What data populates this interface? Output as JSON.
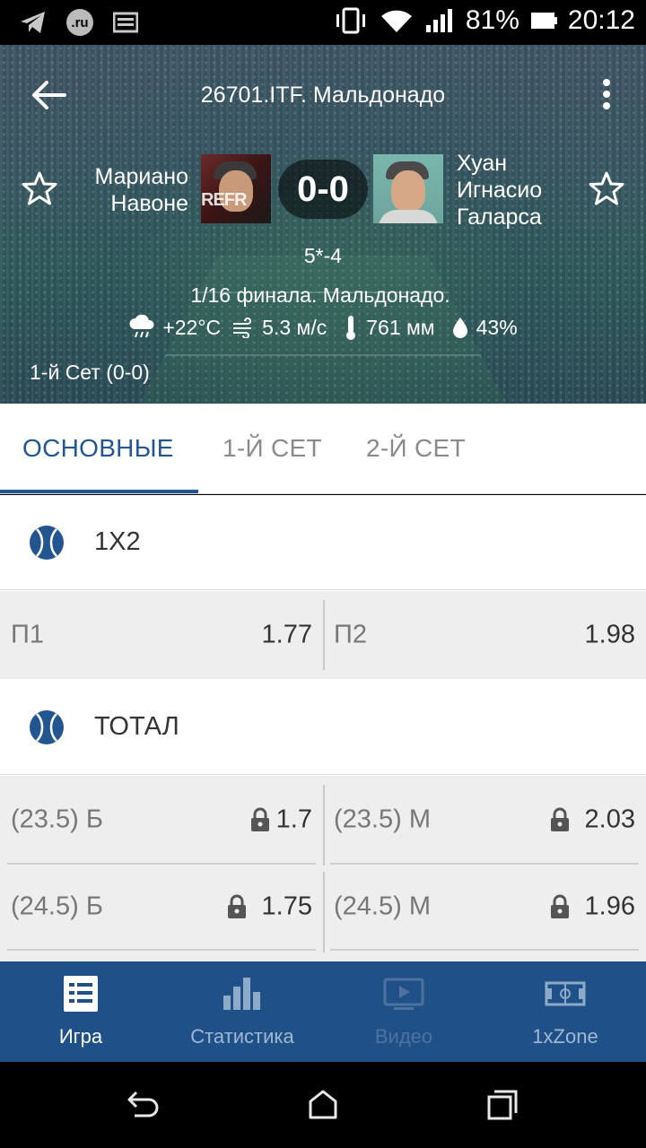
{
  "status_bar": {
    "battery": "81%",
    "time": "20:12",
    "ru_badge": ".ru",
    "icons": [
      "telegram-icon",
      "ru-badge",
      "news-icon",
      "vibrate-icon",
      "wifi-icon",
      "signal-icon",
      "battery-icon"
    ]
  },
  "header": {
    "title": "26701.ITF. Мальдонадо",
    "player1": {
      "name_line1": "Мариано",
      "name_line2": "Навоне",
      "photo_text": "REFR"
    },
    "player2": {
      "name_line1": "Хуан",
      "name_line2": "Игнасио",
      "name_line3": "Галарса"
    },
    "score": "0-0",
    "game_score": "5*-4",
    "round": "1/16 финала. Мальдонадо.",
    "weather": {
      "temperature": "+22°C",
      "wind": "5.3 м/с",
      "pressure": "761 мм",
      "humidity": "43%"
    },
    "set_info": "1-й Сет (0-0)"
  },
  "tabs": [
    {
      "label": "ОСНОВНЫЕ",
      "active": true
    },
    {
      "label": "1-Й СЕТ",
      "active": false
    },
    {
      "label": "2-Й СЕТ",
      "active": false
    }
  ],
  "markets": {
    "m1x2": {
      "title": "1X2",
      "rows": [
        [
          {
            "name": "П1",
            "value": "1.77",
            "locked": false
          },
          {
            "name": "П2",
            "value": "1.98",
            "locked": false
          }
        ]
      ]
    },
    "total": {
      "title": "ТОТАЛ",
      "rows": [
        [
          {
            "name": "(23.5) Б",
            "value": "1.7",
            "locked": true
          },
          {
            "name": "(23.5) М",
            "value": "2.03",
            "locked": true
          }
        ],
        [
          {
            "name": "(24.5) Б",
            "value": "1.75",
            "locked": true
          },
          {
            "name": "(24.5) М",
            "value": "1.96",
            "locked": true
          }
        ]
      ]
    }
  },
  "bottom_nav": [
    {
      "label": "Игра",
      "active": true
    },
    {
      "label": "Статистика",
      "active": false
    },
    {
      "label": "Видео",
      "active": false,
      "disabled": true
    },
    {
      "label": "1xZone",
      "active": false
    }
  ],
  "colors": {
    "accent": "#235591",
    "nav_bg": "#1f5188",
    "odds_bg": "#eeeeee"
  }
}
